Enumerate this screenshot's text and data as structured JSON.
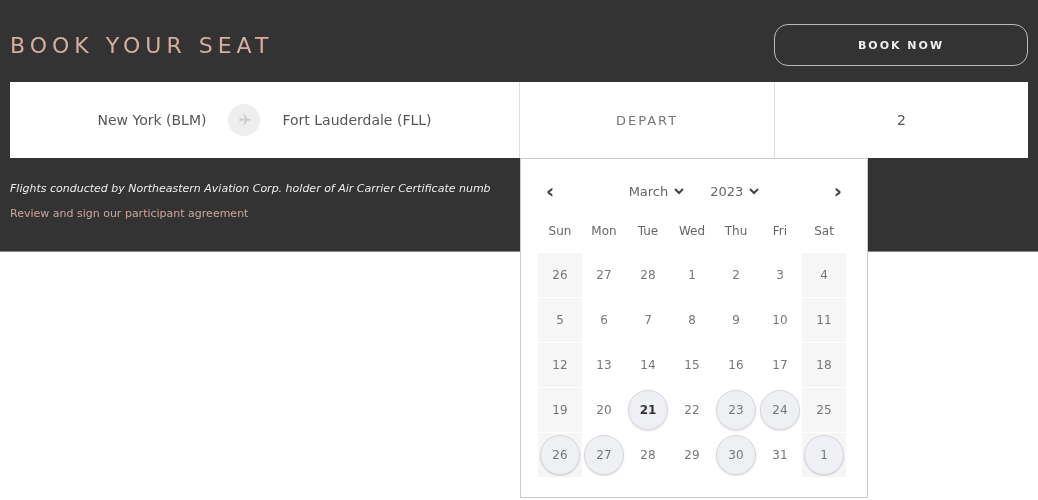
{
  "title": "BOOK YOUR SEAT",
  "book_button": "BOOK NOW",
  "search_bar": {
    "origin": "New York (BLM)",
    "destination": "Fort Lauderdale (FLL)",
    "depart": {
      "placeholder": "DEPART"
    },
    "passengers": "2"
  },
  "disclaimer": "Flights conducted by Northeastern Aviation Corp. holder of Air Carrier Certificate numb",
  "agreement_link": "Review and sign our participant agreement",
  "calendar": {
    "prev": "‹",
    "month": "March",
    "year": "2023",
    "next": "›",
    "weekdays": [
      "Sun",
      "Mon",
      "Tue",
      "Wed",
      "Thu",
      "Fri",
      "Sat"
    ],
    "days": [
      {
        "label": "26",
        "available": false,
        "today": false
      },
      {
        "label": "27",
        "available": false,
        "today": false
      },
      {
        "label": "28",
        "available": false,
        "today": false
      },
      {
        "label": "1",
        "available": false,
        "today": false
      },
      {
        "label": "2",
        "available": false,
        "today": false
      },
      {
        "label": "3",
        "available": false,
        "today": false
      },
      {
        "label": "4",
        "available": false,
        "today": false
      },
      {
        "label": "5",
        "available": false,
        "today": false
      },
      {
        "label": "6",
        "available": false,
        "today": false
      },
      {
        "label": "7",
        "available": false,
        "today": false
      },
      {
        "label": "8",
        "available": false,
        "today": false
      },
      {
        "label": "9",
        "available": false,
        "today": false
      },
      {
        "label": "10",
        "available": false,
        "today": false
      },
      {
        "label": "11",
        "available": false,
        "today": false
      },
      {
        "label": "12",
        "available": false,
        "today": false
      },
      {
        "label": "13",
        "available": false,
        "today": false
      },
      {
        "label": "14",
        "available": false,
        "today": false
      },
      {
        "label": "15",
        "available": false,
        "today": false
      },
      {
        "label": "16",
        "available": false,
        "today": false
      },
      {
        "label": "17",
        "available": false,
        "today": false
      },
      {
        "label": "18",
        "available": false,
        "today": false
      },
      {
        "label": "19",
        "available": false,
        "today": false
      },
      {
        "label": "20",
        "available": false,
        "today": false
      },
      {
        "label": "21",
        "available": true,
        "today": true
      },
      {
        "label": "22",
        "available": false,
        "today": false
      },
      {
        "label": "23",
        "available": true,
        "today": false
      },
      {
        "label": "24",
        "available": true,
        "today": false
      },
      {
        "label": "25",
        "available": false,
        "today": false
      },
      {
        "label": "26",
        "available": true,
        "today": false
      },
      {
        "label": "27",
        "available": true,
        "today": false
      },
      {
        "label": "28",
        "available": false,
        "today": false
      },
      {
        "label": "29",
        "available": false,
        "today": false
      },
      {
        "label": "30",
        "available": true,
        "today": false
      },
      {
        "label": "31",
        "available": false,
        "today": false
      },
      {
        "label": "1",
        "available": true,
        "today": false
      }
    ]
  }
}
